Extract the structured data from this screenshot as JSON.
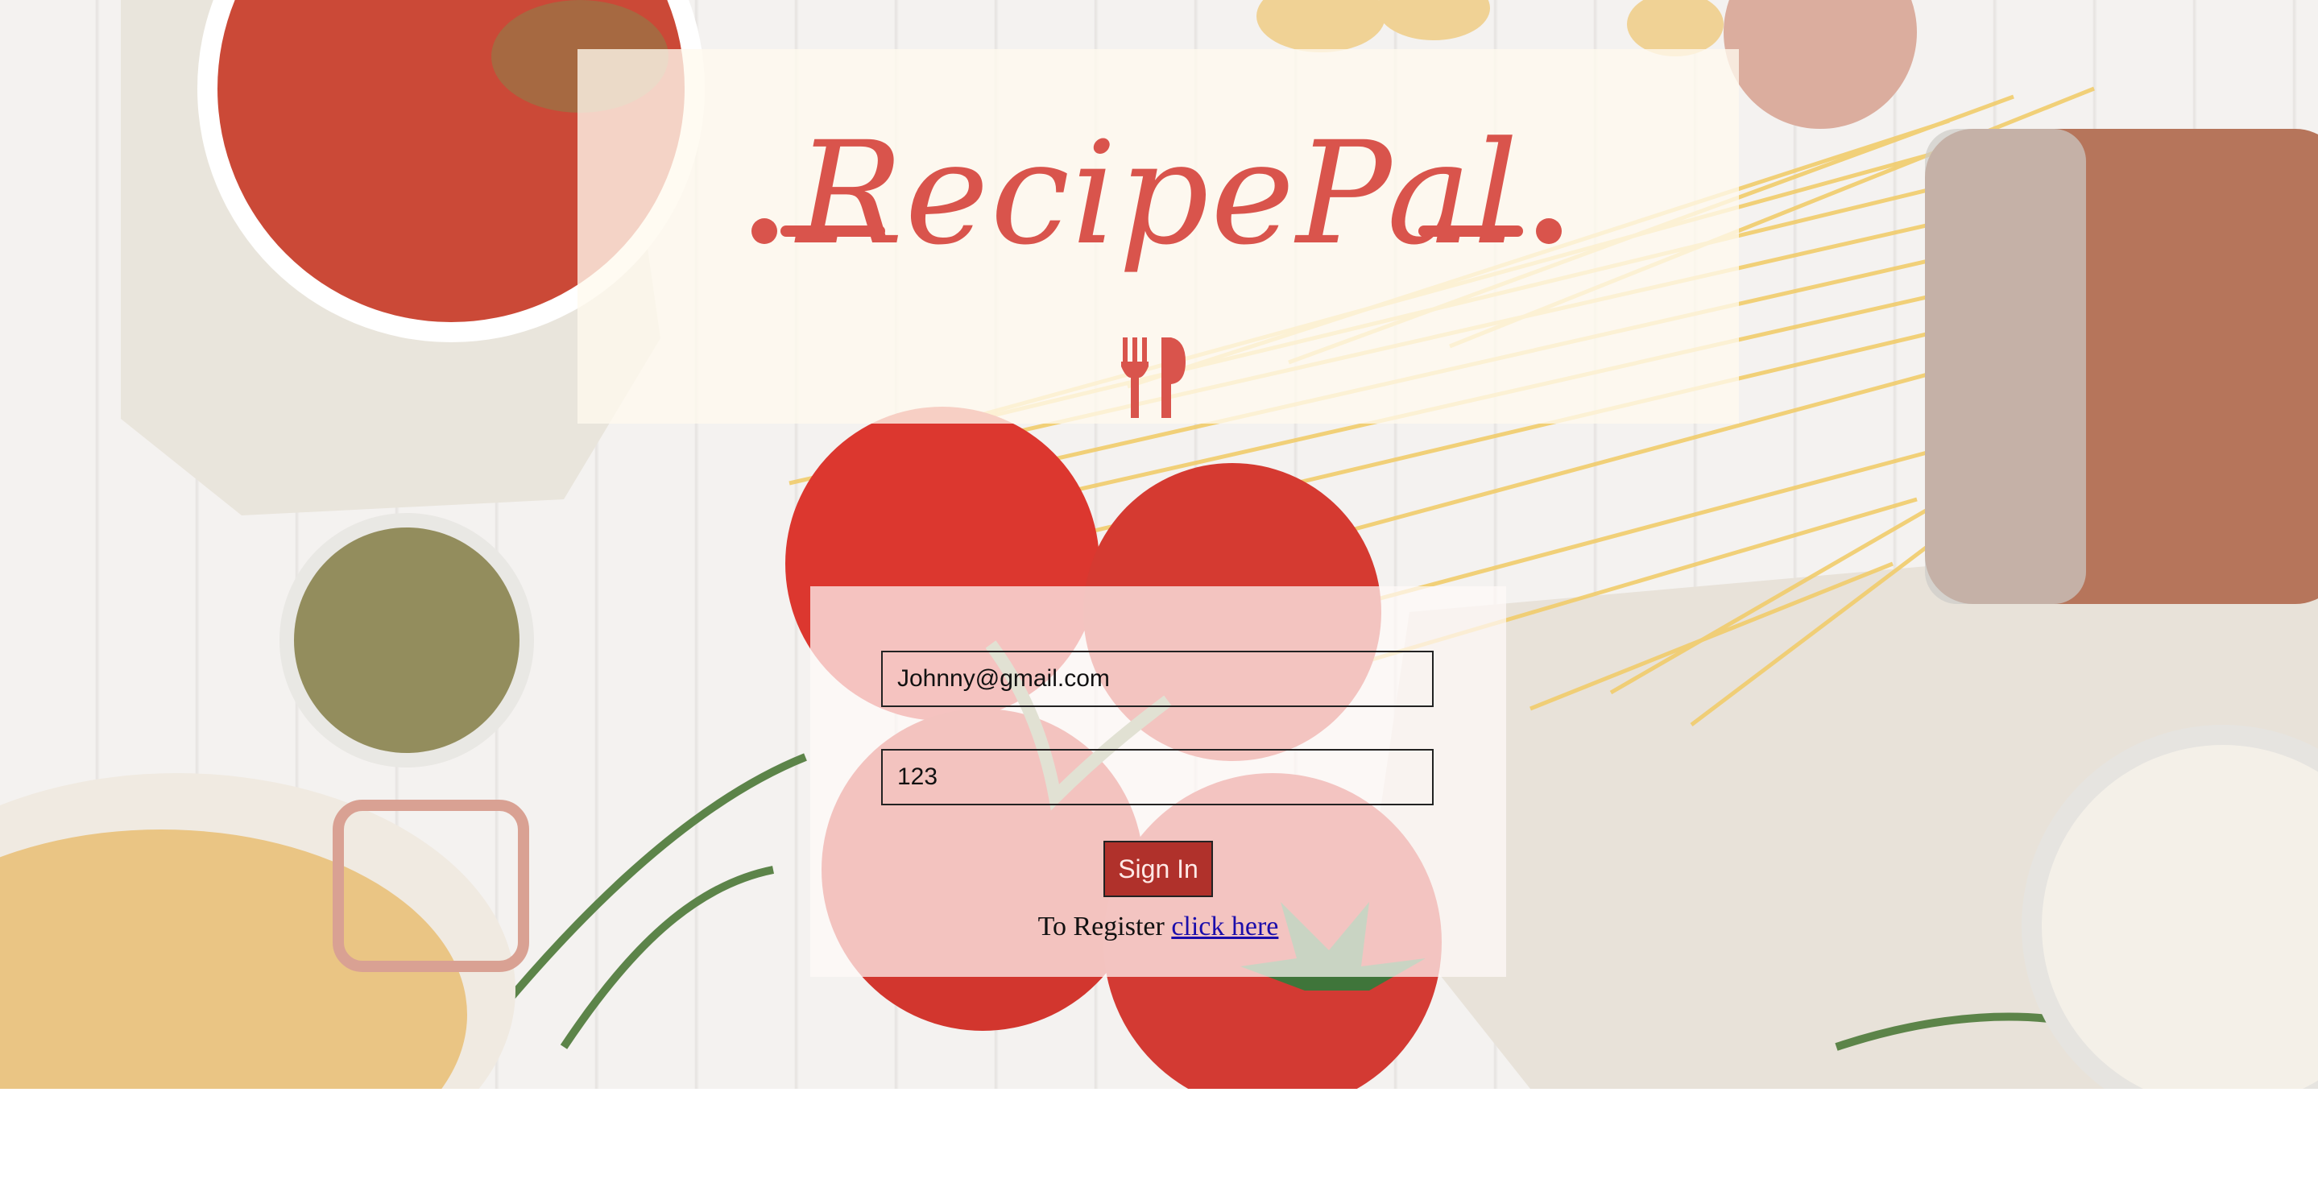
{
  "app": {
    "title": "RecipePal"
  },
  "login_form": {
    "email_value": "Johnny@gmail.com",
    "password_value": "123",
    "sign_in_label": "Sign In",
    "register_prompt": "To Register",
    "register_link_label": "click here"
  },
  "colors": {
    "brand": "#d9544c",
    "button": "#b0312b",
    "link": "#1a0dab"
  },
  "icons": {
    "logo_mark": "fork-and-knife-icon"
  }
}
